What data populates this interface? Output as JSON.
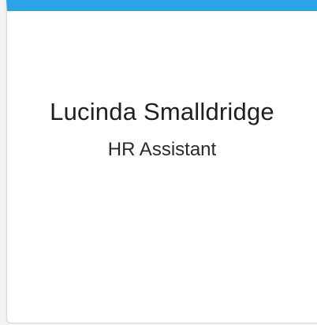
{
  "employee_card": {
    "name": "Lucinda Smalldridge",
    "job_title": "HR Assistant",
    "accent_color": "#2aa3e8"
  }
}
